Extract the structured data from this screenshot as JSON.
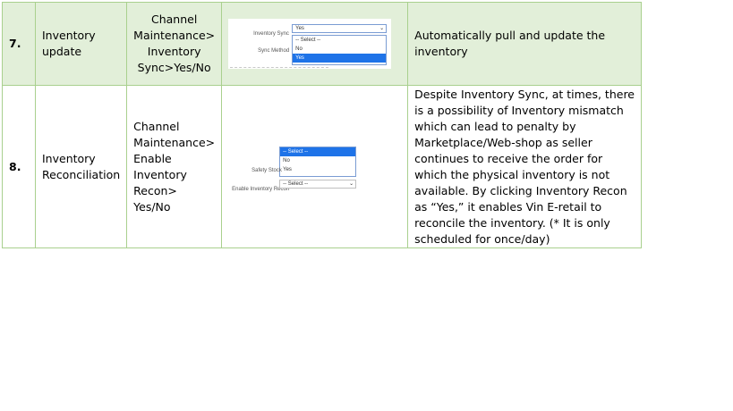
{
  "rows": [
    {
      "number": "7.",
      "task": [
        "Inventory",
        "update"
      ],
      "path": [
        "Channel",
        "Maintenance>",
        "Inventory",
        "Sync>Yes/No"
      ],
      "screenshot": {
        "field1_label": "Inventory Sync",
        "field1_value": "Yes",
        "field2_label": "Sync Method",
        "options": [
          "-- Select --",
          "No",
          "Yes"
        ],
        "highlighted_option": "Yes"
      },
      "description": [
        "Automatically pull and update the",
        "inventory"
      ]
    },
    {
      "number": "8.",
      "task": [
        "Inventory",
        "Reconciliation"
      ],
      "path": [
        "Channel",
        "Maintenance>",
        "Enable",
        "Inventory",
        "Recon>",
        "Yes/No"
      ],
      "screenshot": {
        "options": [
          "-- Select --",
          "No",
          "Yes"
        ],
        "highlighted_option": "-- Select --",
        "field1_label": "Safety Stock",
        "field2_label": "Enable Inventory Recon",
        "field2_value": "-- Select --"
      },
      "description": [
        "Despite Inventory Sync, at times, there",
        "is a possibility of Inventory mismatch",
        "which can lead to penalty by",
        "Marketplace/Web-shop as seller",
        "continues to receive the order for",
        "which the physical inventory is not",
        "available.  By clicking Inventory Recon",
        "as “Yes,” it enables Vin E-retail to",
        "reconcile the inventory. (* It is only",
        "scheduled for once/day)"
      ]
    }
  ]
}
